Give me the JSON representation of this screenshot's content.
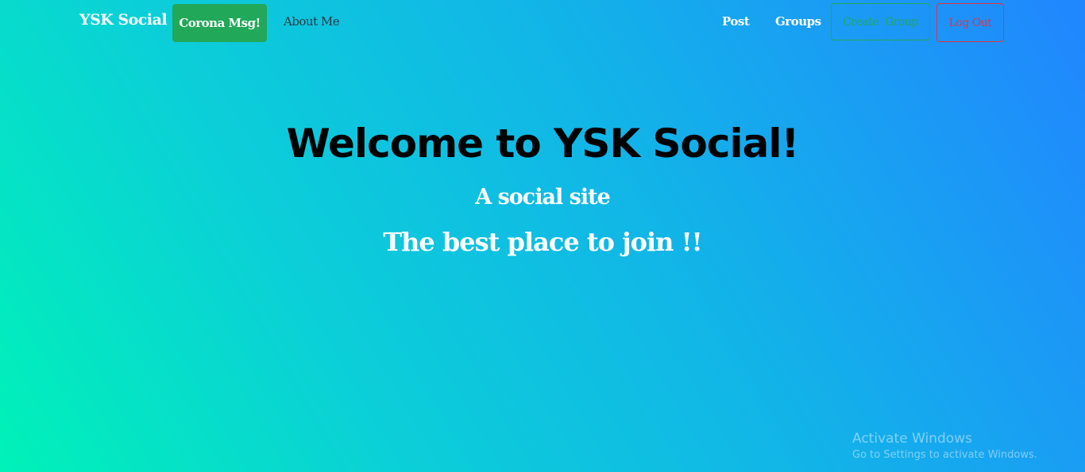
{
  "navbar": {
    "brand": "YSK Social",
    "corona_button": "Corona Msg!",
    "about_link": "About Me",
    "post_link": "Post",
    "groups_link": "Groups",
    "create_group_button": "Create  Group",
    "logout_button": "Log Out"
  },
  "hero": {
    "title": "Welcome to YSK Social!",
    "subtitle": "A social site",
    "tagline": "The best place to join !!"
  },
  "watermark": {
    "title": "Activate Windows",
    "subtitle": "Go to Settings to activate Windows."
  },
  "colors": {
    "success": "#21a858",
    "danger": "#dc3545",
    "gradient_start": "#00f2b8",
    "gradient_end": "#2186ff"
  }
}
